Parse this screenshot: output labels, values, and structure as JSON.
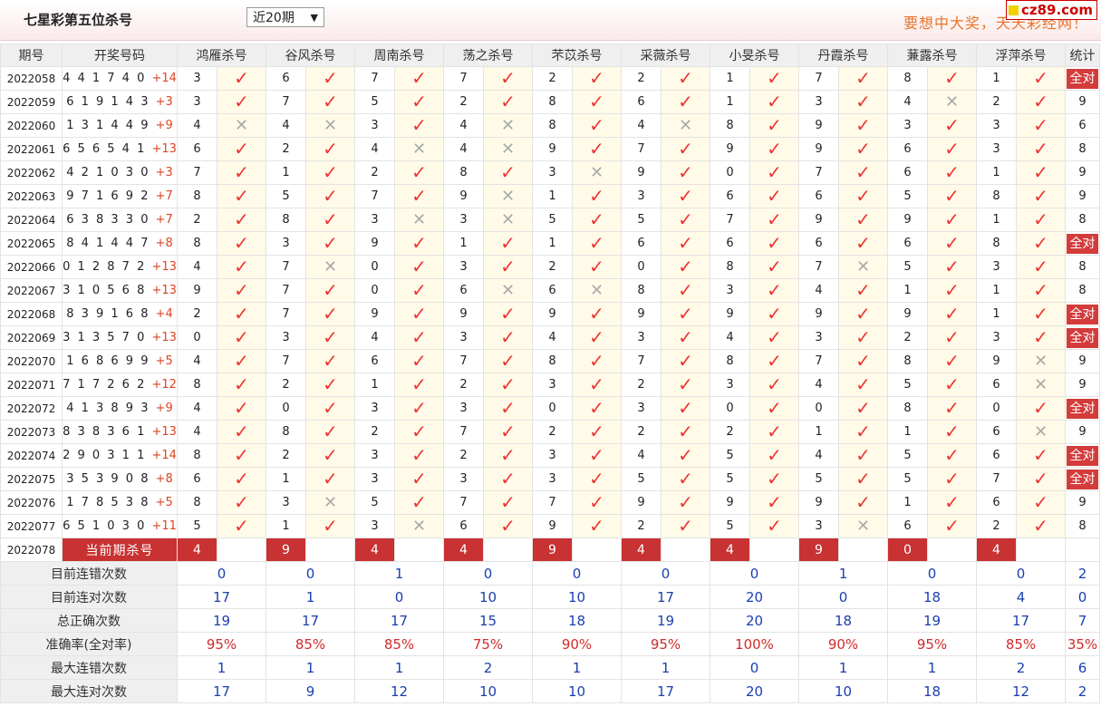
{
  "header": {
    "title": "七星彩第五位杀号",
    "period_select": "近20期",
    "slogan": "要想中大奖，天天彩经网！",
    "logo": "cz89.com"
  },
  "table": {
    "headers": [
      "期号",
      "开奖号码",
      "鸿雁杀号",
      "谷风杀号",
      "周南杀号",
      "荡之杀号",
      "芣苡杀号",
      "采薇杀号",
      "小旻杀号",
      "丹霞杀号",
      "蒹露杀号",
      "浮萍杀号",
      "统计"
    ],
    "all_correct_label": "全对",
    "rows": [
      {
        "period": "2022058",
        "draw": "4 4 1 7 4 0",
        "sum": "+14",
        "k": [
          [
            3,
            1
          ],
          [
            6,
            1
          ],
          [
            7,
            1
          ],
          [
            7,
            1
          ],
          [
            2,
            1
          ],
          [
            2,
            1
          ],
          [
            1,
            1
          ],
          [
            7,
            1
          ],
          [
            8,
            1
          ],
          [
            1,
            1
          ]
        ],
        "stat": "全对"
      },
      {
        "period": "2022059",
        "draw": "6 1 9 1 4 3",
        "sum": "+3",
        "k": [
          [
            3,
            1
          ],
          [
            7,
            1
          ],
          [
            5,
            1
          ],
          [
            2,
            1
          ],
          [
            8,
            1
          ],
          [
            6,
            1
          ],
          [
            1,
            1
          ],
          [
            3,
            1
          ],
          [
            4,
            0
          ],
          [
            2,
            1
          ]
        ],
        "stat": "9"
      },
      {
        "period": "2022060",
        "draw": "1 3 1 4 4 9",
        "sum": "+9",
        "k": [
          [
            4,
            0
          ],
          [
            4,
            0
          ],
          [
            3,
            1
          ],
          [
            4,
            0
          ],
          [
            8,
            1
          ],
          [
            4,
            0
          ],
          [
            8,
            1
          ],
          [
            9,
            1
          ],
          [
            3,
            1
          ],
          [
            3,
            1
          ]
        ],
        "stat": "6"
      },
      {
        "period": "2022061",
        "draw": "6 5 6 5 4 1",
        "sum": "+13",
        "k": [
          [
            6,
            1
          ],
          [
            2,
            1
          ],
          [
            4,
            0
          ],
          [
            4,
            0
          ],
          [
            9,
            1
          ],
          [
            7,
            1
          ],
          [
            9,
            1
          ],
          [
            9,
            1
          ],
          [
            6,
            1
          ],
          [
            3,
            1
          ]
        ],
        "stat": "8"
      },
      {
        "period": "2022062",
        "draw": "4 2 1 0 3 0",
        "sum": "+3",
        "k": [
          [
            7,
            1
          ],
          [
            1,
            1
          ],
          [
            2,
            1
          ],
          [
            8,
            1
          ],
          [
            3,
            0
          ],
          [
            9,
            1
          ],
          [
            0,
            1
          ],
          [
            7,
            1
          ],
          [
            6,
            1
          ],
          [
            1,
            1
          ]
        ],
        "stat": "9"
      },
      {
        "period": "2022063",
        "draw": "9 7 1 6 9 2",
        "sum": "+7",
        "k": [
          [
            8,
            1
          ],
          [
            5,
            1
          ],
          [
            7,
            1
          ],
          [
            9,
            0
          ],
          [
            1,
            1
          ],
          [
            3,
            1
          ],
          [
            6,
            1
          ],
          [
            6,
            1
          ],
          [
            5,
            1
          ],
          [
            8,
            1
          ]
        ],
        "stat": "9"
      },
      {
        "period": "2022064",
        "draw": "6 3 8 3 3 0",
        "sum": "+7",
        "k": [
          [
            2,
            1
          ],
          [
            8,
            1
          ],
          [
            3,
            0
          ],
          [
            3,
            0
          ],
          [
            5,
            1
          ],
          [
            5,
            1
          ],
          [
            7,
            1
          ],
          [
            9,
            1
          ],
          [
            9,
            1
          ],
          [
            1,
            1
          ]
        ],
        "stat": "8"
      },
      {
        "period": "2022065",
        "draw": "8 4 1 4 4 7",
        "sum": "+8",
        "k": [
          [
            8,
            1
          ],
          [
            3,
            1
          ],
          [
            9,
            1
          ],
          [
            1,
            1
          ],
          [
            1,
            1
          ],
          [
            6,
            1
          ],
          [
            6,
            1
          ],
          [
            6,
            1
          ],
          [
            6,
            1
          ],
          [
            8,
            1
          ]
        ],
        "stat": "全对"
      },
      {
        "period": "2022066",
        "draw": "0 1 2 8 7 2",
        "sum": "+13",
        "k": [
          [
            4,
            1
          ],
          [
            7,
            0
          ],
          [
            0,
            1
          ],
          [
            3,
            1
          ],
          [
            2,
            1
          ],
          [
            0,
            1
          ],
          [
            8,
            1
          ],
          [
            7,
            0
          ],
          [
            5,
            1
          ],
          [
            3,
            1
          ]
        ],
        "stat": "8"
      },
      {
        "period": "2022067",
        "draw": "3 1 0 5 6 8",
        "sum": "+13",
        "k": [
          [
            9,
            1
          ],
          [
            7,
            1
          ],
          [
            0,
            1
          ],
          [
            6,
            0
          ],
          [
            6,
            0
          ],
          [
            8,
            1
          ],
          [
            3,
            1
          ],
          [
            4,
            1
          ],
          [
            1,
            1
          ],
          [
            1,
            1
          ]
        ],
        "stat": "8"
      },
      {
        "period": "2022068",
        "draw": "8 3 9 1 6 8",
        "sum": "+4",
        "k": [
          [
            2,
            1
          ],
          [
            7,
            1
          ],
          [
            9,
            1
          ],
          [
            9,
            1
          ],
          [
            9,
            1
          ],
          [
            9,
            1
          ],
          [
            9,
            1
          ],
          [
            9,
            1
          ],
          [
            9,
            1
          ],
          [
            1,
            1
          ]
        ],
        "stat": "全对"
      },
      {
        "period": "2022069",
        "draw": "3 1 3 5 7 0",
        "sum": "+13",
        "k": [
          [
            0,
            1
          ],
          [
            3,
            1
          ],
          [
            4,
            1
          ],
          [
            3,
            1
          ],
          [
            4,
            1
          ],
          [
            3,
            1
          ],
          [
            4,
            1
          ],
          [
            3,
            1
          ],
          [
            2,
            1
          ],
          [
            3,
            1
          ]
        ],
        "stat": "全对"
      },
      {
        "period": "2022070",
        "draw": "1 6 8 6 9 9",
        "sum": "+5",
        "k": [
          [
            4,
            1
          ],
          [
            7,
            1
          ],
          [
            6,
            1
          ],
          [
            7,
            1
          ],
          [
            8,
            1
          ],
          [
            7,
            1
          ],
          [
            8,
            1
          ],
          [
            7,
            1
          ],
          [
            8,
            1
          ],
          [
            9,
            0
          ]
        ],
        "stat": "9"
      },
      {
        "period": "2022071",
        "draw": "7 1 7 2 6 2",
        "sum": "+12",
        "k": [
          [
            8,
            1
          ],
          [
            2,
            1
          ],
          [
            1,
            1
          ],
          [
            2,
            1
          ],
          [
            3,
            1
          ],
          [
            2,
            1
          ],
          [
            3,
            1
          ],
          [
            4,
            1
          ],
          [
            5,
            1
          ],
          [
            6,
            0
          ]
        ],
        "stat": "9"
      },
      {
        "period": "2022072",
        "draw": "4 1 3 8 9 3",
        "sum": "+9",
        "k": [
          [
            4,
            1
          ],
          [
            0,
            1
          ],
          [
            3,
            1
          ],
          [
            3,
            1
          ],
          [
            0,
            1
          ],
          [
            3,
            1
          ],
          [
            0,
            1
          ],
          [
            0,
            1
          ],
          [
            8,
            1
          ],
          [
            0,
            1
          ]
        ],
        "stat": "全对"
      },
      {
        "period": "2022073",
        "draw": "8 3 8 3 6 1",
        "sum": "+13",
        "k": [
          [
            4,
            1
          ],
          [
            8,
            1
          ],
          [
            2,
            1
          ],
          [
            7,
            1
          ],
          [
            2,
            1
          ],
          [
            2,
            1
          ],
          [
            2,
            1
          ],
          [
            1,
            1
          ],
          [
            1,
            1
          ],
          [
            6,
            0
          ]
        ],
        "stat": "9"
      },
      {
        "period": "2022074",
        "draw": "2 9 0 3 1 1",
        "sum": "+14",
        "k": [
          [
            8,
            1
          ],
          [
            2,
            1
          ],
          [
            3,
            1
          ],
          [
            2,
            1
          ],
          [
            3,
            1
          ],
          [
            4,
            1
          ],
          [
            5,
            1
          ],
          [
            4,
            1
          ],
          [
            5,
            1
          ],
          [
            6,
            1
          ]
        ],
        "stat": "全对"
      },
      {
        "period": "2022075",
        "draw": "3 5 3 9 0 8",
        "sum": "+8",
        "k": [
          [
            6,
            1
          ],
          [
            1,
            1
          ],
          [
            3,
            1
          ],
          [
            3,
            1
          ],
          [
            3,
            1
          ],
          [
            5,
            1
          ],
          [
            5,
            1
          ],
          [
            5,
            1
          ],
          [
            5,
            1
          ],
          [
            7,
            1
          ]
        ],
        "stat": "全对"
      },
      {
        "period": "2022076",
        "draw": "1 7 8 5 3 8",
        "sum": "+5",
        "k": [
          [
            8,
            1
          ],
          [
            3,
            0
          ],
          [
            5,
            1
          ],
          [
            7,
            1
          ],
          [
            7,
            1
          ],
          [
            9,
            1
          ],
          [
            9,
            1
          ],
          [
            9,
            1
          ],
          [
            1,
            1
          ],
          [
            6,
            1
          ]
        ],
        "stat": "9"
      },
      {
        "period": "2022077",
        "draw": "6 5 1 0 3 0",
        "sum": "+11",
        "k": [
          [
            5,
            1
          ],
          [
            1,
            1
          ],
          [
            3,
            0
          ],
          [
            6,
            1
          ],
          [
            9,
            1
          ],
          [
            2,
            1
          ],
          [
            5,
            1
          ],
          [
            3,
            0
          ],
          [
            6,
            1
          ],
          [
            2,
            1
          ]
        ],
        "stat": "8"
      }
    ],
    "current": {
      "period": "2022078",
      "label": "当前期杀号",
      "kills": [
        "4",
        "9",
        "4",
        "4",
        "9",
        "4",
        "4",
        "9",
        "0",
        "4"
      ]
    },
    "stats": [
      {
        "label": "目前连错次数",
        "values": [
          "0",
          "0",
          "1",
          "0",
          "0",
          "0",
          "0",
          "1",
          "0",
          "0",
          "2"
        ],
        "red": false
      },
      {
        "label": "目前连对次数",
        "values": [
          "17",
          "1",
          "0",
          "10",
          "10",
          "17",
          "20",
          "0",
          "18",
          "4",
          "0"
        ],
        "red": false
      },
      {
        "label": "总正确次数",
        "values": [
          "19",
          "17",
          "17",
          "15",
          "18",
          "19",
          "20",
          "18",
          "19",
          "17",
          "7"
        ],
        "red": false
      },
      {
        "label": "准确率(全对率)",
        "values": [
          "95%",
          "85%",
          "85%",
          "75%",
          "90%",
          "95%",
          "100%",
          "90%",
          "95%",
          "85%",
          "35%"
        ],
        "red": true
      },
      {
        "label": "最大连错次数",
        "values": [
          "1",
          "1",
          "1",
          "2",
          "1",
          "1",
          "0",
          "1",
          "1",
          "2",
          "6"
        ],
        "red": false
      },
      {
        "label": "最大连对次数",
        "values": [
          "17",
          "9",
          "12",
          "10",
          "10",
          "17",
          "20",
          "10",
          "18",
          "12",
          "2"
        ],
        "red": false
      }
    ]
  },
  "icons": {
    "correct": "check-icon",
    "wrong": "cross-icon"
  },
  "colors": {
    "accent": "#c83232",
    "stat_blue": "#1a3fb0",
    "check_red": "#e33333"
  }
}
